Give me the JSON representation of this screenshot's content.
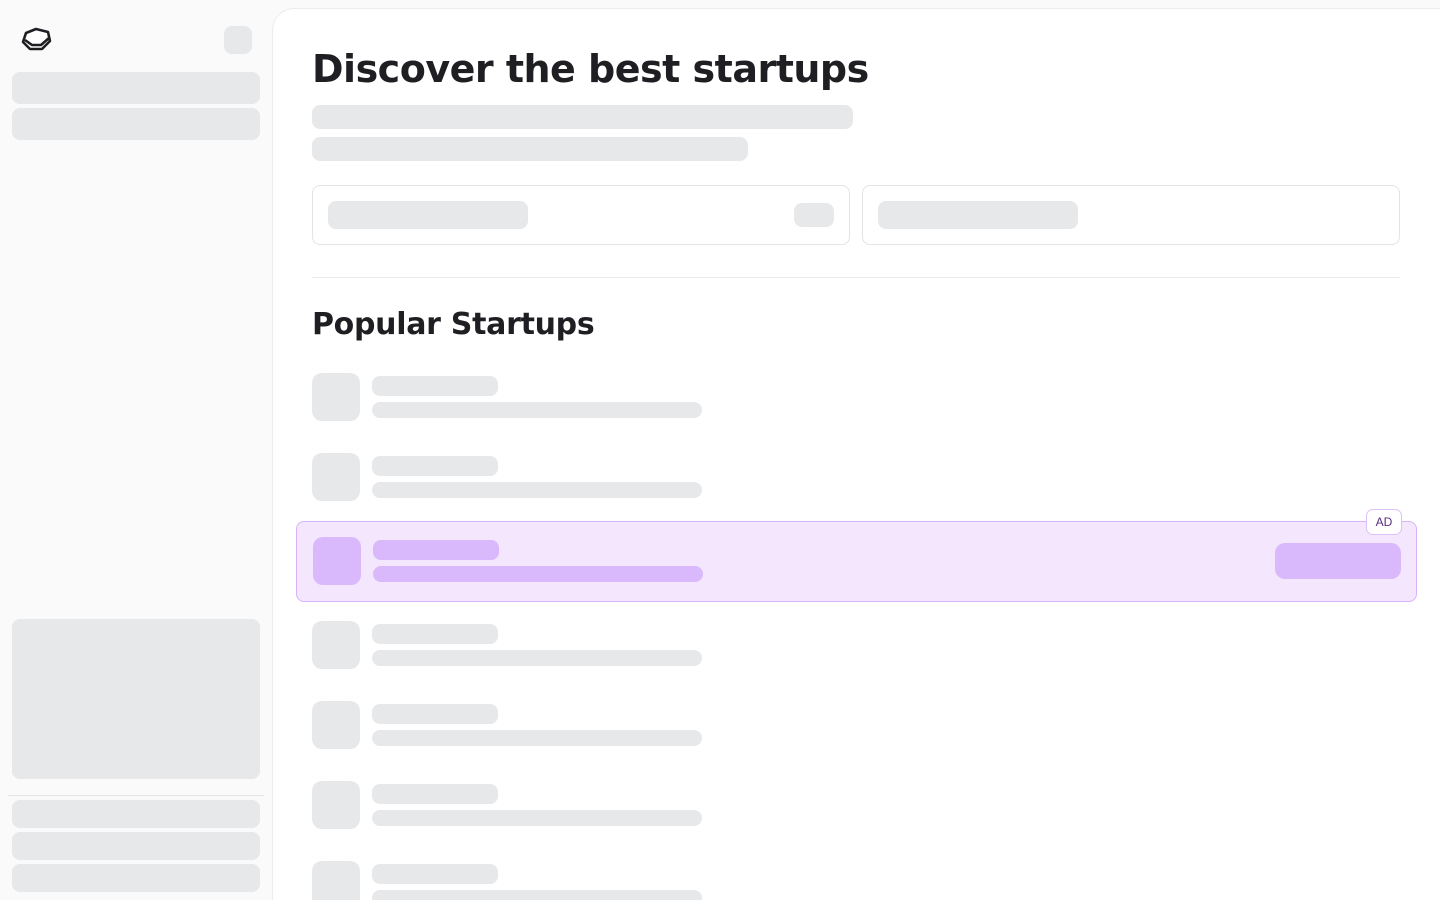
{
  "header": {
    "title": "Discover the best startups"
  },
  "popular": {
    "title": "Popular Startups",
    "ad_badge": "AD"
  },
  "icons": {
    "logo": "hexagon-logo-icon"
  },
  "colors": {
    "skeleton": "#e7e8ea",
    "ad_background": "#f3e6fd",
    "ad_border": "#d7b4f9",
    "ad_skeleton": "#d9b8fb",
    "text": "#1f1f23"
  },
  "state": "loading"
}
